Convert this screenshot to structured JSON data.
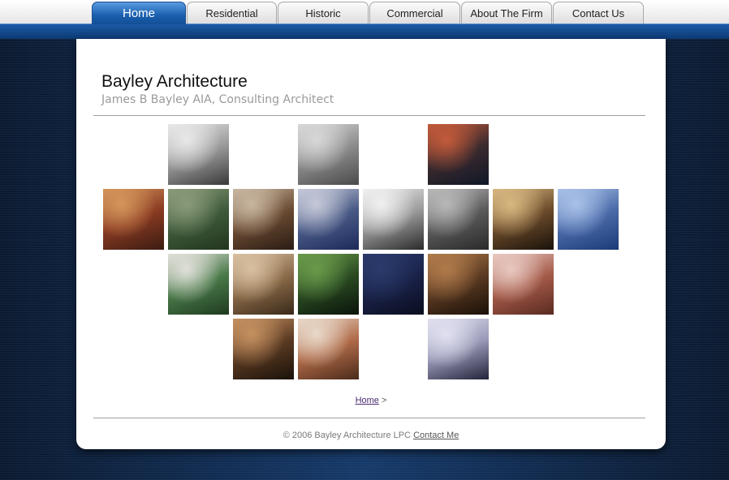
{
  "nav": {
    "tabs": [
      {
        "label": "Home",
        "active": true
      },
      {
        "label": "Residential",
        "active": false
      },
      {
        "label": "Historic",
        "active": false
      },
      {
        "label": "Commercial",
        "active": false
      },
      {
        "label": "About The Firm",
        "active": false
      },
      {
        "label": "Contact Us",
        "active": false
      }
    ]
  },
  "header": {
    "title": "Bayley Architecture",
    "subtitle": "James B Bayley AIA, Consulting Architect"
  },
  "gallery": {
    "photos": [
      {
        "name": "portrait-photo",
        "colors": [
          "#e8e8e8",
          "#9a9a9a",
          "#3a3a3a"
        ]
      },
      {
        "name": "window-facade-photo",
        "colors": [
          "#d8d8d8",
          "#8c8c8c",
          "#4a4a4a"
        ]
      },
      {
        "name": "skylight-atrium-photo",
        "colors": [
          "#c25a3a",
          "#3a2a2e",
          "#111827"
        ]
      },
      {
        "name": "red-barn-house-photo",
        "colors": [
          "#d4955a",
          "#8a3a22",
          "#3a1c12"
        ]
      },
      {
        "name": "aerial-estate-photo",
        "colors": [
          "#8a9a78",
          "#3e5a3a",
          "#22351e"
        ]
      },
      {
        "name": "modern-kitchen-photo",
        "colors": [
          "#c8b6a0",
          "#6a4a32",
          "#2a1c14"
        ]
      },
      {
        "name": "townhouse-row-photo",
        "colors": [
          "#c4c8d8",
          "#4a5a86",
          "#1c2a5a"
        ]
      },
      {
        "name": "classical-entrance-photo",
        "colors": [
          "#f0f0f0",
          "#9a9a9a",
          "#2a2a2a"
        ]
      },
      {
        "name": "stone-townhouse-photo",
        "colors": [
          "#b8b8b8",
          "#5a5a5a",
          "#2a2a2a"
        ]
      },
      {
        "name": "brownstone-stoop-photo",
        "colors": [
          "#d8b880",
          "#6a4a2a",
          "#1a120a"
        ]
      },
      {
        "name": "modern-highrise-photo",
        "colors": [
          "#a8c0e8",
          "#4a6aa8",
          "#1a3a78"
        ]
      },
      {
        "name": "southern-porch-house-photo",
        "colors": [
          "#e0e0d8",
          "#4a7a4a",
          "#1e3a1e"
        ]
      },
      {
        "name": "tudor-house-photo",
        "colors": [
          "#d8c0a0",
          "#8a6a48",
          "#3a2a1a"
        ]
      },
      {
        "name": "garden-pool-photo",
        "colors": [
          "#6a9a4a",
          "#2a4a22",
          "#0a140a"
        ]
      },
      {
        "name": "dusk-house-photo",
        "colors": [
          "#2a3a6a",
          "#1a2248",
          "#0a0e20"
        ]
      },
      {
        "name": "library-interior-photo",
        "colors": [
          "#b07a4a",
          "#5a3a22",
          "#1a1008"
        ]
      },
      {
        "name": "brick-mansion-photo",
        "colors": [
          "#e8c8c0",
          "#a45a48",
          "#5a2a22"
        ]
      },
      {
        "name": "indoor-pool-photo",
        "colors": [
          "#c49060",
          "#5a3a22",
          "#1a120a"
        ]
      },
      {
        "name": "staircase-interior-photo",
        "colors": [
          "#e8d8c8",
          "#b06a48",
          "#4a2a1a"
        ]
      },
      {
        "name": "dining-room-photo",
        "colors": [
          "#e0e0f0",
          "#9a9ab8",
          "#22223a"
        ]
      }
    ]
  },
  "breadcrumb": {
    "home_label": "Home",
    "separator": ">"
  },
  "footer": {
    "copyright": "© 2006 Bayley Architecture LPC",
    "contact_label": "Contact Me"
  }
}
